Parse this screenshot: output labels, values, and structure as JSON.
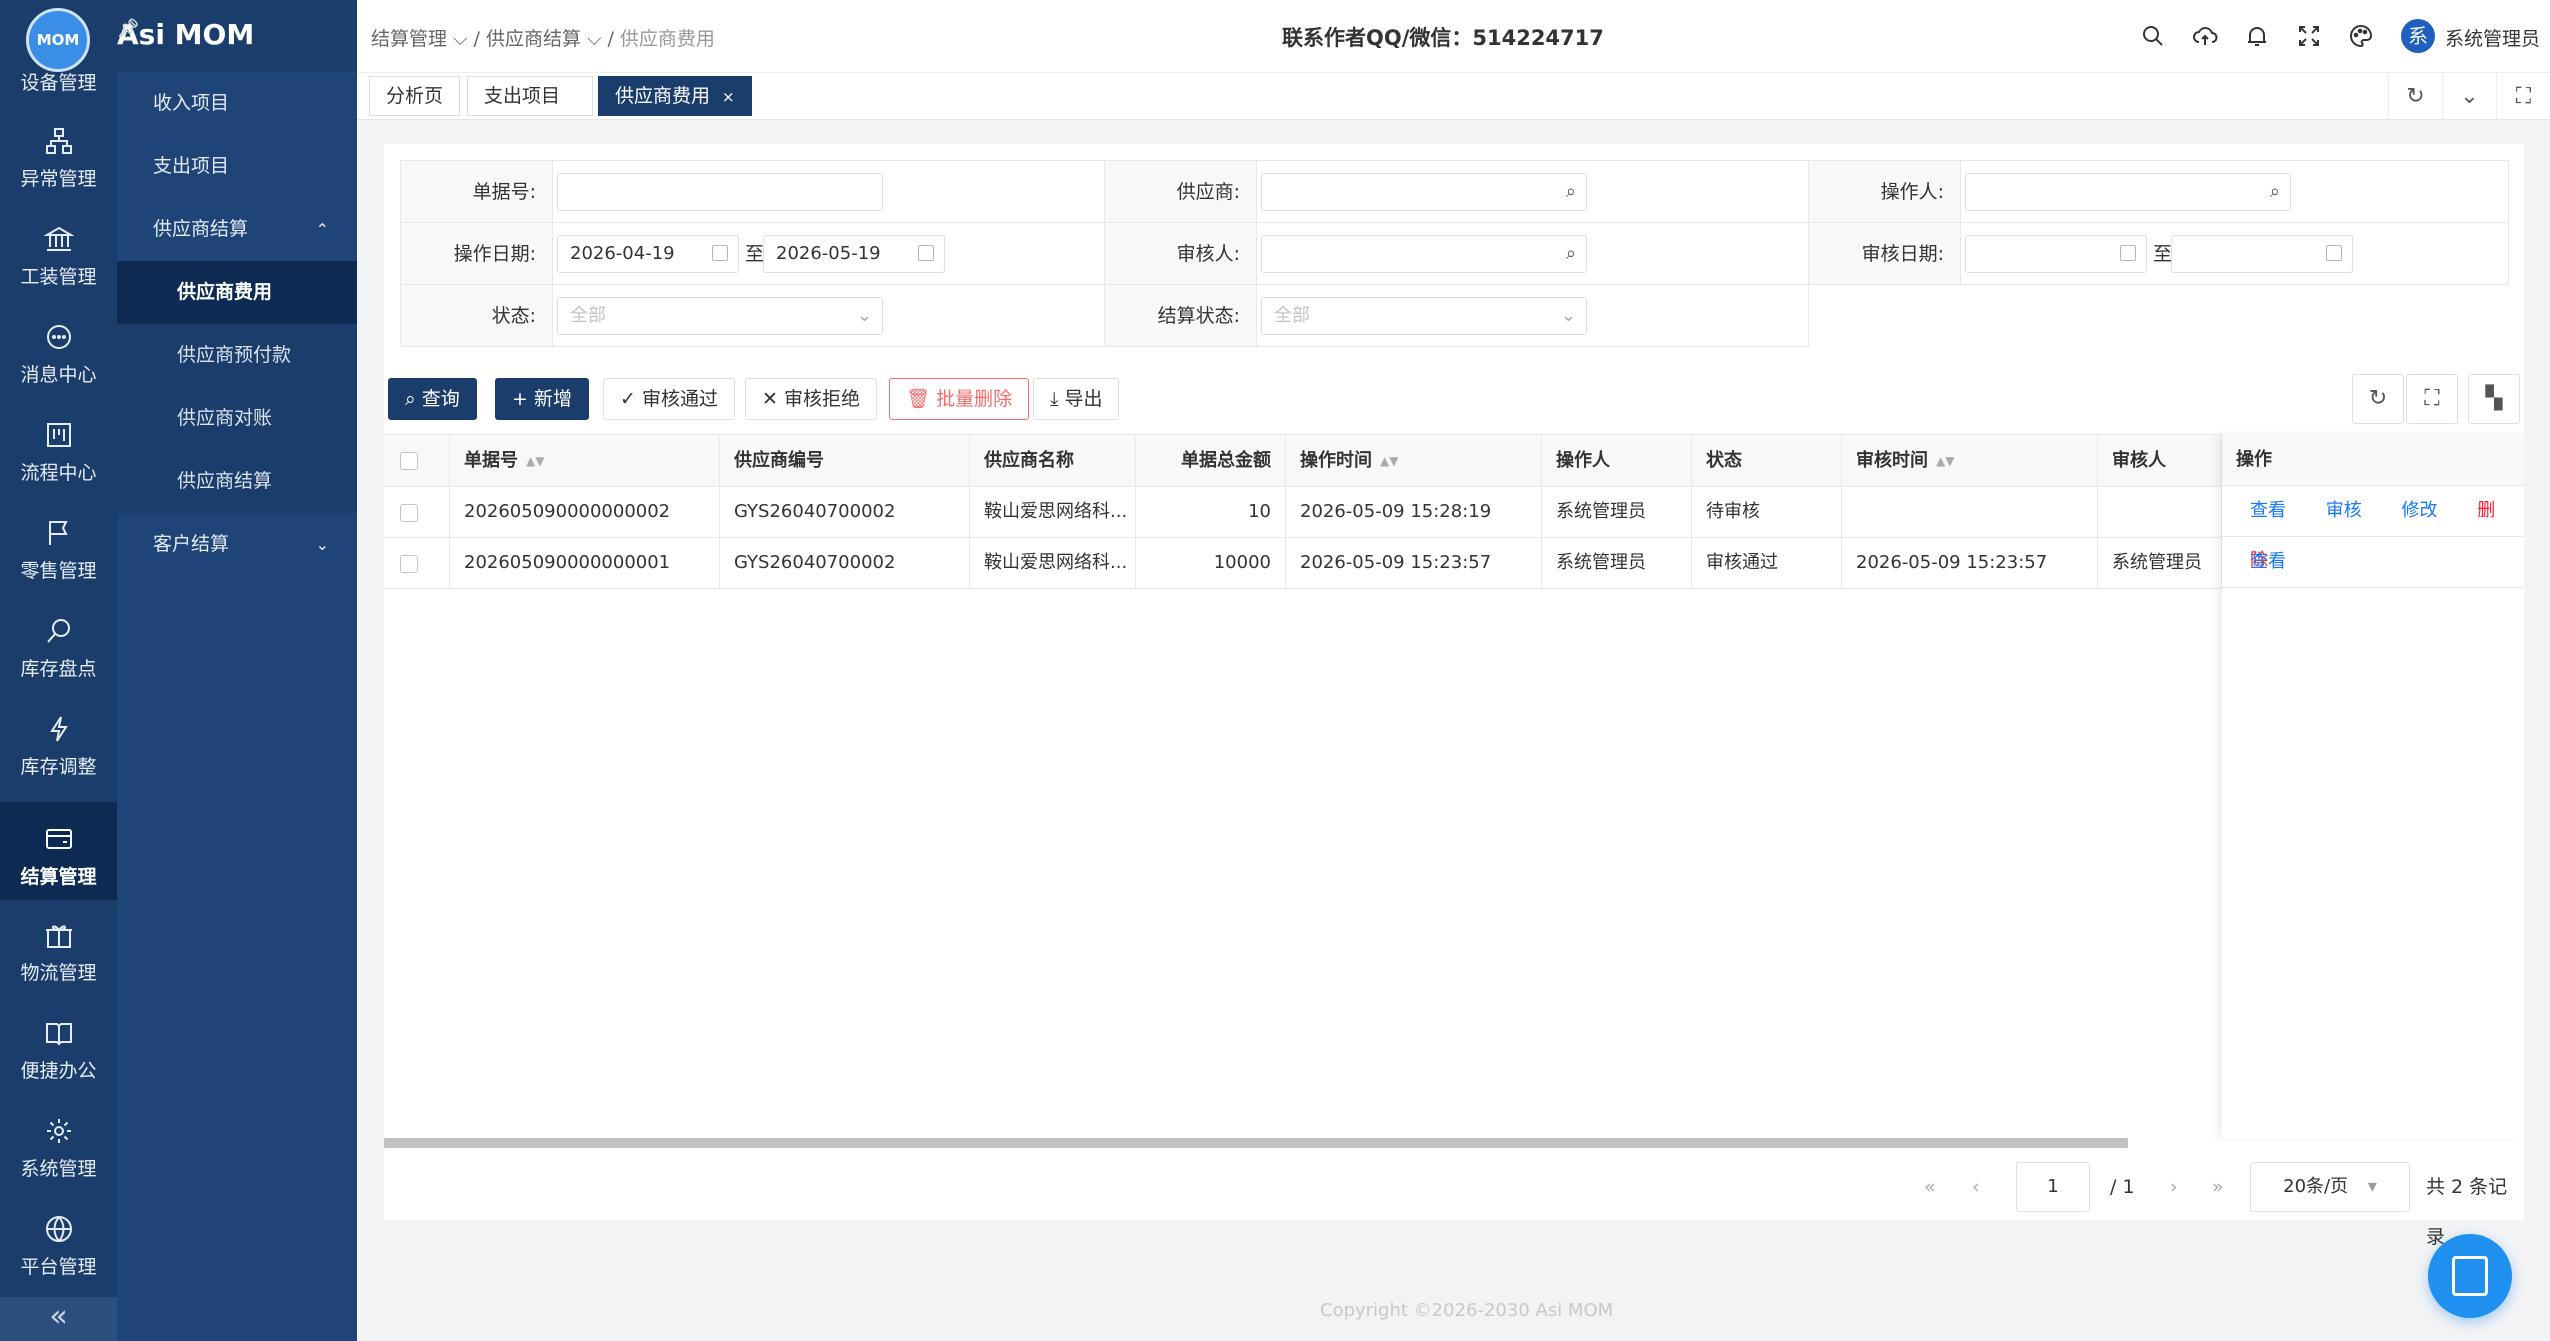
{
  "app": {
    "logo_text": "MOM",
    "brand": "Asi MOM"
  },
  "rail": [
    "设备管理",
    "异常管理",
    "工装管理",
    "消息中心",
    "流程中心",
    "零售管理",
    "库存盘点",
    "库存调整",
    "结算管理",
    "物流管理",
    "便捷办公",
    "系统管理",
    "平台管理"
  ],
  "rail_active": "结算管理",
  "sidebar": {
    "items": [
      {
        "label": "收入项目"
      },
      {
        "label": "支出项目"
      },
      {
        "label": "供应商结算",
        "chev": "⌃"
      },
      {
        "label": "供应商费用"
      },
      {
        "label": "供应商预付款"
      },
      {
        "label": "供应商对账"
      },
      {
        "label": "供应商结算"
      },
      {
        "label": "客户结算",
        "chev": "⌄"
      }
    ]
  },
  "header": {
    "breadcrumb": [
      "结算管理",
      "供应商结算",
      "供应商费用"
    ],
    "center_title": "联系作者QQ/微信：514224717",
    "avatar": "系",
    "user": "系统管理员"
  },
  "tabs": [
    {
      "label": "分析页"
    },
    {
      "label": "支出项目"
    },
    {
      "label": "供应商费用",
      "close": "×"
    }
  ],
  "form": {
    "doc_no_label": "单据号:",
    "supplier_label": "供应商:",
    "operator_label": "操作人:",
    "op_date_label": "操作日期:",
    "op_date_from": "2026-04-19",
    "op_date_to": "2026-05-19",
    "to": "至",
    "auditor_label": "审核人:",
    "audit_date_label": "审核日期:",
    "status_label": "状态:",
    "status_ph": "全部",
    "settle_status_label": "结算状态:",
    "settle_status_ph": "全部"
  },
  "toolbar": {
    "query": "查询",
    "add": "新增",
    "approve": "审核通过",
    "reject": "审核拒绝",
    "batch_delete": "批量删除",
    "export": "导出"
  },
  "table": {
    "columns": [
      "单据号",
      "供应商编号",
      "供应商名称",
      "单据总金额",
      "操作时间",
      "操作人",
      "状态",
      "审核时间",
      "审核人",
      "操作"
    ],
    "rows": [
      {
        "doc_no": "202605090000000002",
        "supplier_code": "GYS26040700002",
        "supplier_name": "鞍山爱思网络科...",
        "amount": "10",
        "op_time": "2026-05-09 15:28:19",
        "operator": "系统管理员",
        "status": "待审核",
        "audit_time": "",
        "auditor": ""
      },
      {
        "doc_no": "202605090000000001",
        "supplier_code": "GYS26040700002",
        "supplier_name": "鞍山爱思网络科...",
        "amount": "10000",
        "op_time": "2026-05-09 15:23:57",
        "operator": "系统管理员",
        "status": "审核通过",
        "audit_time": "2026-05-09 15:23:57",
        "auditor": "系统管理员"
      }
    ],
    "actions": {
      "view": "查看",
      "audit": "审核",
      "edit": "修改",
      "delete": "删除"
    }
  },
  "pager": {
    "page": "1",
    "total_pages": "/ 1",
    "page_size": "20条/页",
    "total": "共 2 条记录"
  },
  "footer": "Copyright ©2026-2030 Asi MOM",
  "colors": {
    "rail": "#1a3d6b",
    "active": "#0d2a52",
    "link": "#1677ff",
    "danger": "#f5222d",
    "fab": "#1f8ff0"
  }
}
